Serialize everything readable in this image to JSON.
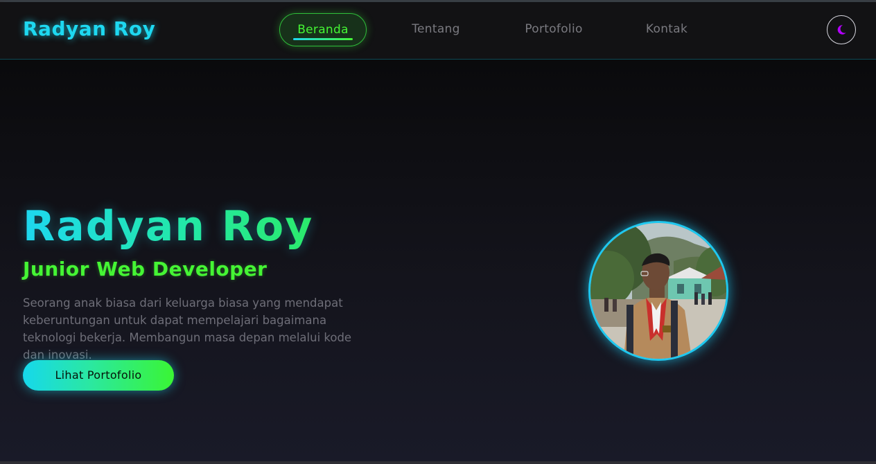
{
  "navbar": {
    "brand": "Radyan Roy",
    "items": [
      {
        "label": "Beranda",
        "active": true
      },
      {
        "label": "Tentang",
        "active": false
      },
      {
        "label": "Portofolio",
        "active": false
      },
      {
        "label": "Kontak",
        "active": false
      }
    ],
    "theme_toggle_icon": "moon-icon"
  },
  "hero": {
    "name": "Radyan Roy",
    "role": "Junior Web Developer",
    "description": "Seorang anak biasa dari keluarga biasa yang mendapat keberuntungan untuk dapat mempelajari bagaimana teknologi bekerja. Membangun masa depan melalui kode dan inovasi.",
    "cta_label": "Lihat Portofolio"
  },
  "colors": {
    "accent_cyan": "#1ed8f0",
    "accent_green": "#45f534",
    "moon": "#b400ff"
  }
}
